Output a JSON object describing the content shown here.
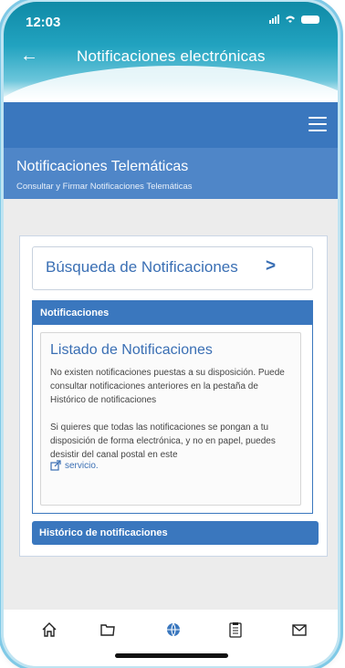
{
  "status": {
    "time": "12:03"
  },
  "appbar": {
    "title": "Notificaciones electrónicas"
  },
  "section": {
    "title": "Notificaciones Telemáticas",
    "subtitle": "Consultar y Firmar Notificaciones Telemáticas"
  },
  "search": {
    "label": "Búsqueda de Notificaciones",
    "arrow": ">"
  },
  "notificaciones": {
    "header": "Notificaciones",
    "title": "Listado de Notificaciones",
    "text1": "No existen notificaciones puestas a su disposición. Puede consultar notificaciones anteriores en la pestaña de Histórico de notificaciones",
    "text2": "Si quieres que todas las notificaciones se pongan a tu disposición de forma electrónica, y no en papel, puedes desistir del canal postal en este",
    "link": "servicio."
  },
  "historico": {
    "label": "Histórico de notificaciones"
  },
  "tabs": [
    {
      "name": "home-icon"
    },
    {
      "name": "folder-icon"
    },
    {
      "name": "globe-icon"
    },
    {
      "name": "clipboard-icon"
    },
    {
      "name": "mail-icon"
    }
  ],
  "colors": {
    "primary": "#3a77be",
    "header": "#1a97b4"
  }
}
